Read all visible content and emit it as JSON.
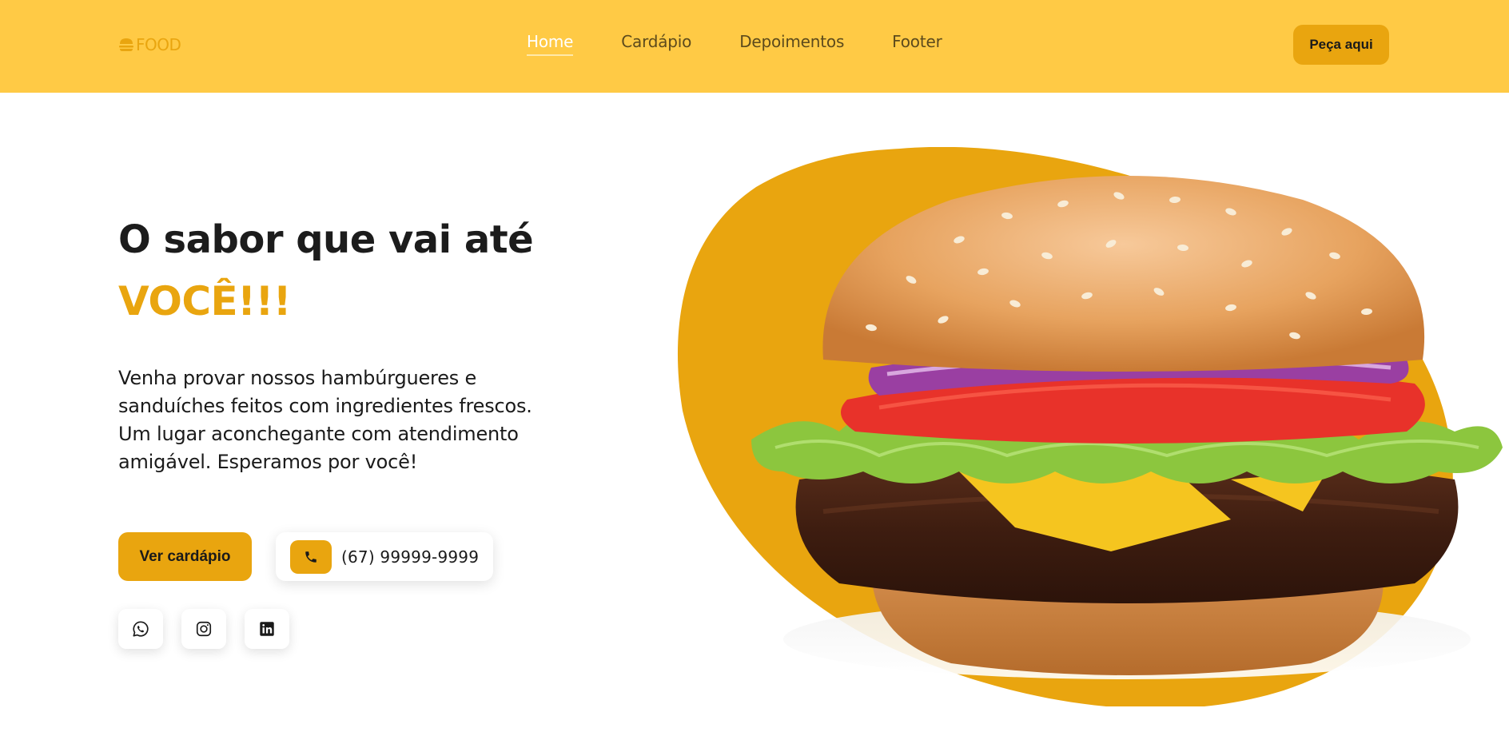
{
  "header": {
    "logo_text": "FOOD",
    "logo_icon": "burger-icon",
    "nav": [
      {
        "label": "Home",
        "active": true
      },
      {
        "label": "Cardápio",
        "active": false
      },
      {
        "label": "Depoimentos",
        "active": false
      },
      {
        "label": "Footer",
        "active": false
      }
    ],
    "order_button": "Peça aqui"
  },
  "hero": {
    "title": "O sabor que vai até",
    "highlight": "VOCÊ!!!",
    "description": "Venha provar nossos hambúrgueres e sanduíches feitos com ingredientes frescos. Um lugar aconchegante com atendimento amigável. Esperamos por você!",
    "menu_button": "Ver cardápio",
    "phone": "(67) 99999-9999",
    "phone_icon": "phone-icon",
    "social": [
      "whatsapp-icon",
      "instagram-icon",
      "linkedin-icon"
    ]
  },
  "colors": {
    "header_bg": "#ffca45",
    "accent": "#e9a50f",
    "text_dark": "#1c1c1c",
    "white": "#ffffff"
  }
}
